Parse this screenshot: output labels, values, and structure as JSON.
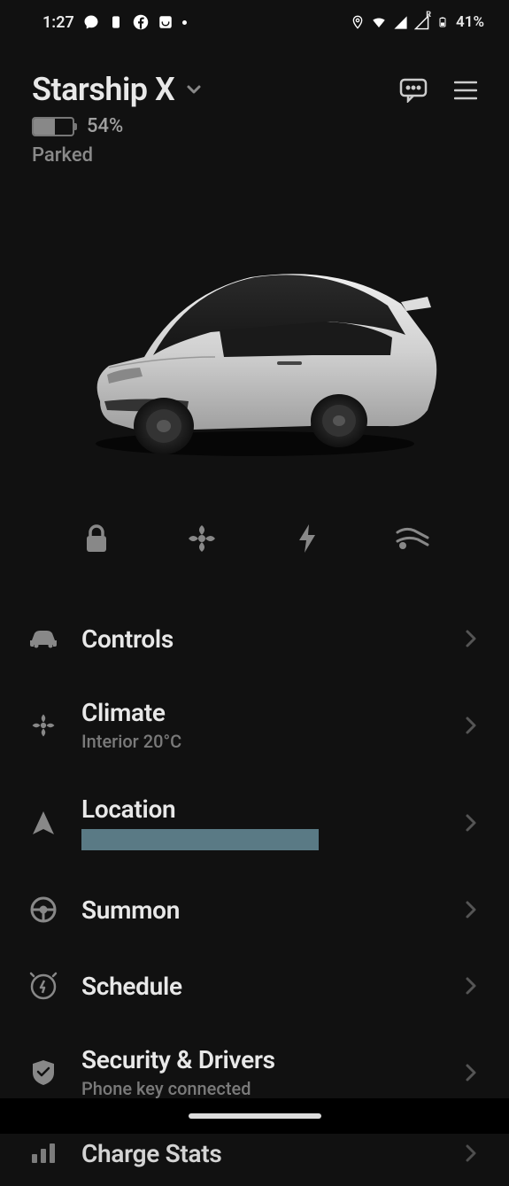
{
  "status_bar": {
    "time": "1:27",
    "battery_pct": "41%"
  },
  "header": {
    "title": "Starship X"
  },
  "vehicle": {
    "battery_pct": "54%",
    "battery_fill_pct": 54,
    "status": "Parked"
  },
  "quick_actions": {
    "lock": "lock",
    "fan": "fan",
    "charge": "charge",
    "frunk": "frunk"
  },
  "menu": [
    {
      "icon": "car",
      "title": "Controls",
      "sub": ""
    },
    {
      "icon": "fan",
      "title": "Climate",
      "sub": "Interior 20°C"
    },
    {
      "icon": "nav",
      "title": "Location",
      "sub": "",
      "redacted": true
    },
    {
      "icon": "wheel",
      "title": "Summon",
      "sub": ""
    },
    {
      "icon": "clock-bolt",
      "title": "Schedule",
      "sub": ""
    },
    {
      "icon": "shield",
      "title": "Security & Drivers",
      "sub": "Phone key connected"
    },
    {
      "icon": "stats",
      "title": "Charge Stats",
      "sub": ""
    }
  ]
}
